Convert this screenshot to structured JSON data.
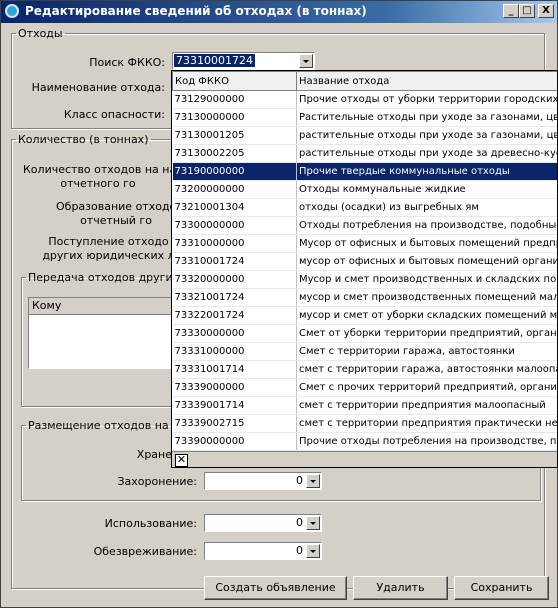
{
  "window": {
    "title": "Редактирование сведений об отходах (в тоннах)",
    "min": "_",
    "max": "□",
    "close": "X"
  },
  "waste_group": {
    "legend": "Отходы",
    "search_label": "Поиск ФККО:",
    "search_value": "73310001724",
    "name_label": "Наименование отхода:",
    "hazard_label": "Класс опасности:"
  },
  "quantity_group": {
    "legend": "Количество (в тоннах)",
    "start_label": "Количество отходов на нача\nотчетного го",
    "formed_label": "Образование отходо\nотчетный го",
    "received_label": "Поступление отходо\nдругих юридических л",
    "transfer": {
      "legend": "Передача отходов другим ю",
      "col_to": "Кому"
    }
  },
  "placement_group": {
    "legend": "Размещение отходов на соб",
    "storage_label": "Хране",
    "burial_label": "Захоронение:",
    "burial_value": "0"
  },
  "use_label": "Использование:",
  "use_value": "0",
  "neutral_label": "Обезвреживание:",
  "neutral_value": "0",
  "buttons": {
    "create": "Создать объявление",
    "delete": "Удалить",
    "save": "Сохранить"
  },
  "dropdown": {
    "col_code": "Код ФККО",
    "col_name": "Название отхода",
    "selected_index": 4,
    "rows": [
      {
        "code": "73129000000",
        "name": "Прочие отходы от уборки территории городских и"
      },
      {
        "code": "73130000000",
        "name": "Растительные отходы при уходе за газонами, цве"
      },
      {
        "code": "73130001205",
        "name": "растительные отходы при уходе за газонами, цвет"
      },
      {
        "code": "73130002205",
        "name": "растительные отходы при уходе за древесно-кусто"
      },
      {
        "code": "73190000000",
        "name": "Прочие твердые коммунальные отходы"
      },
      {
        "code": "73200000000",
        "name": "Отходы коммунальные жидкие"
      },
      {
        "code": "73210001304",
        "name": "отходы (осадки) из выгребных ям"
      },
      {
        "code": "73300000000",
        "name": "Отходы потребления на производстве, подобные"
      },
      {
        "code": "73310000000",
        "name": "Мусор от офисных и бытовых помещений предприя"
      },
      {
        "code": "73310001724",
        "name": "мусор от офисных и бытовых помещений организа"
      },
      {
        "code": "73320000000",
        "name": "Мусор и смет производственных и складских помещ"
      },
      {
        "code": "73321001724",
        "name": "мусор и смет производственных помещений малооп"
      },
      {
        "code": "73322001724",
        "name": "мусор и смет от уборки складских помещений мало"
      },
      {
        "code": "73330000000",
        "name": "Смет от уборки территории предприятий, организа"
      },
      {
        "code": "73331000000",
        "name": "Смет с территории гаража, автостоянки"
      },
      {
        "code": "73331001714",
        "name": "смет с территории гаража, автостоянки малоопас"
      },
      {
        "code": "73339000000",
        "name": "Смет с прочих территорий предприятий, организа"
      },
      {
        "code": "73339001714",
        "name": "смет с территории предприятия малоопасный"
      },
      {
        "code": "73339002715",
        "name": "смет с территории предприятия практически неопа"
      },
      {
        "code": "73390000000",
        "name": "Прочие отходы потребления на производстве, подоб"
      }
    ]
  }
}
